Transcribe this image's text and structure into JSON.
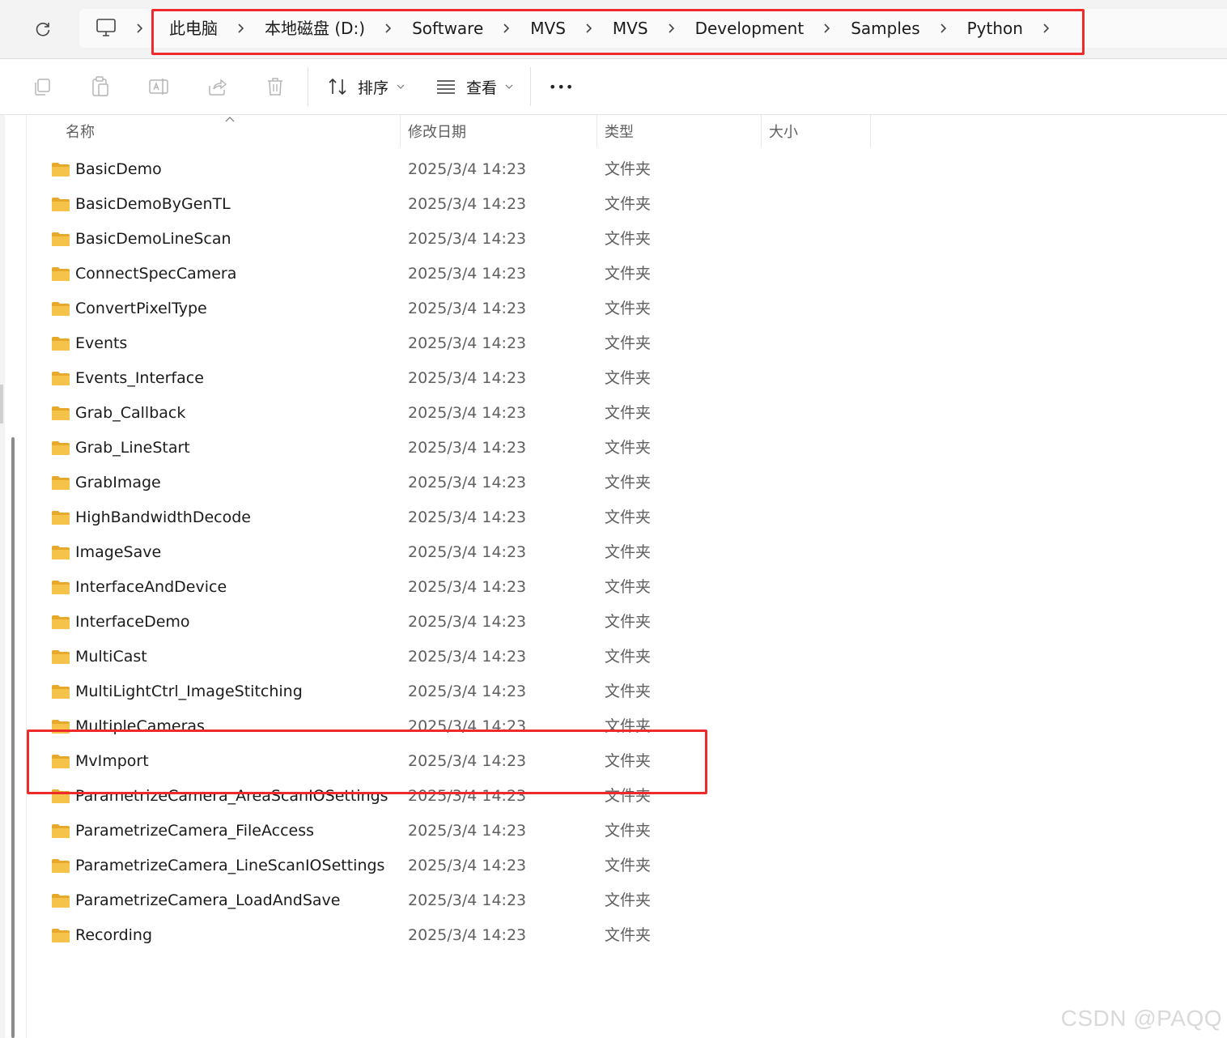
{
  "breadcrumb": {
    "items": [
      "此电脑",
      "本地磁盘 (D:)",
      "Software",
      "MVS",
      "MVS",
      "Development",
      "Samples",
      "Python"
    ]
  },
  "toolbar": {
    "sort_label": "排序",
    "view_label": "查看",
    "more_label": "•••",
    "icons": [
      "copy-icon",
      "paste-icon",
      "rename-icon",
      "share-icon",
      "delete-icon"
    ]
  },
  "columns": {
    "name": "名称",
    "modified": "修改日期",
    "type": "类型",
    "size": "大小"
  },
  "rows": [
    {
      "name": "BasicDemo",
      "date": "2025/3/4 14:23",
      "type": "文件夹"
    },
    {
      "name": "BasicDemoByGenTL",
      "date": "2025/3/4 14:23",
      "type": "文件夹"
    },
    {
      "name": "BasicDemoLineScan",
      "date": "2025/3/4 14:23",
      "type": "文件夹"
    },
    {
      "name": "ConnectSpecCamera",
      "date": "2025/3/4 14:23",
      "type": "文件夹"
    },
    {
      "name": "ConvertPixelType",
      "date": "2025/3/4 14:23",
      "type": "文件夹"
    },
    {
      "name": "Events",
      "date": "2025/3/4 14:23",
      "type": "文件夹"
    },
    {
      "name": "Events_Interface",
      "date": "2025/3/4 14:23",
      "type": "文件夹"
    },
    {
      "name": "Grab_Callback",
      "date": "2025/3/4 14:23",
      "type": "文件夹"
    },
    {
      "name": "Grab_LineStart",
      "date": "2025/3/4 14:23",
      "type": "文件夹"
    },
    {
      "name": "GrabImage",
      "date": "2025/3/4 14:23",
      "type": "文件夹"
    },
    {
      "name": "HighBandwidthDecode",
      "date": "2025/3/4 14:23",
      "type": "文件夹"
    },
    {
      "name": "ImageSave",
      "date": "2025/3/4 14:23",
      "type": "文件夹"
    },
    {
      "name": "InterfaceAndDevice",
      "date": "2025/3/4 14:23",
      "type": "文件夹"
    },
    {
      "name": "InterfaceDemo",
      "date": "2025/3/4 14:23",
      "type": "文件夹"
    },
    {
      "name": "MultiCast",
      "date": "2025/3/4 14:23",
      "type": "文件夹"
    },
    {
      "name": "MultiLightCtrl_ImageStitching",
      "date": "2025/3/4 14:23",
      "type": "文件夹"
    },
    {
      "name": "MultipleCameras",
      "date": "2025/3/4 14:23",
      "type": "文件夹"
    },
    {
      "name": "MvImport",
      "date": "2025/3/4 14:23",
      "type": "文件夹"
    },
    {
      "name": "ParametrizeCamera_AreaScanIOSettings",
      "date": "2025/3/4 14:23",
      "type": "文件夹"
    },
    {
      "name": "ParametrizeCamera_FileAccess",
      "date": "2025/3/4 14:23",
      "type": "文件夹"
    },
    {
      "name": "ParametrizeCamera_LineScanIOSettings",
      "date": "2025/3/4 14:23",
      "type": "文件夹"
    },
    {
      "name": "ParametrizeCamera_LoadAndSave",
      "date": "2025/3/4 14:23",
      "type": "文件夹"
    },
    {
      "name": "Recording",
      "date": "2025/3/4 14:23",
      "type": "文件夹"
    }
  ],
  "highlight": {
    "color": "#ef2a2a",
    "row": "MvImport"
  },
  "watermark": "CSDN @PAQQ",
  "colors": {
    "folder": "#f6c34a",
    "folder_dark": "#e6a92b",
    "accent": "#005fb8"
  }
}
